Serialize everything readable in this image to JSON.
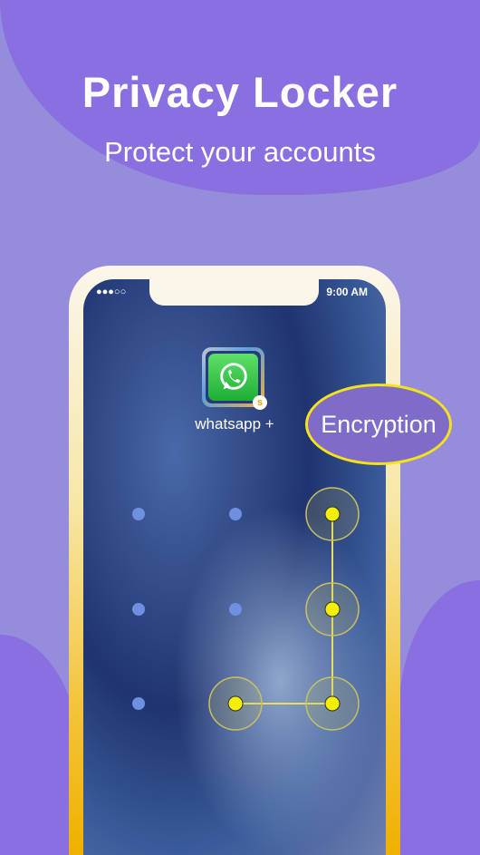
{
  "header": {
    "title": "Privacy Locker",
    "subtitle": "Protect your accounts"
  },
  "status_bar": {
    "signal": "●●●○○",
    "time": "9:00 AM"
  },
  "app": {
    "label": "whatsapp +",
    "badge": "s",
    "icon": "whatsapp-icon"
  },
  "callout": {
    "label": "Encryption"
  },
  "pattern": {
    "grid": 3,
    "selected_sequence": [
      2,
      5,
      8,
      7
    ],
    "dot_color": "#6f8fe0",
    "active_color": "#f4f000"
  },
  "colors": {
    "background": "#958ddb",
    "accent": "#8a6fe0",
    "callout_border": "#f4e21a"
  }
}
